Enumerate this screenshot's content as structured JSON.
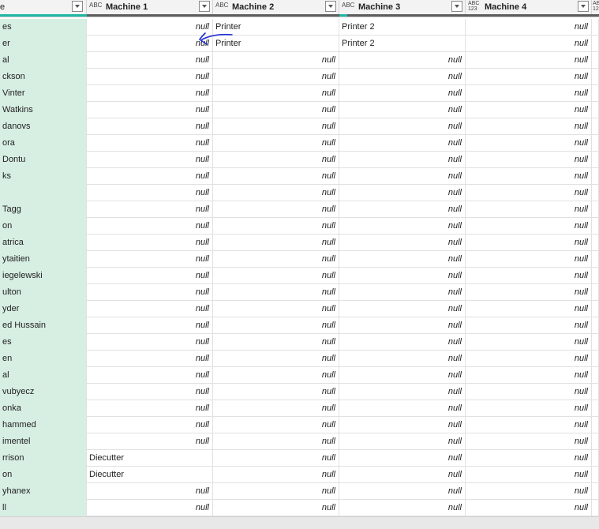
{
  "header": {
    "col0_label": "e",
    "columns": [
      {
        "type_icon": "ABC",
        "label": "Machine 1"
      },
      {
        "type_icon": "ABC",
        "label": "Machine 2"
      },
      {
        "type_icon": "ABC",
        "label": "Machine 3"
      },
      {
        "type_icon": "ABC 123",
        "label": "Machine 4"
      },
      {
        "type_icon": "ABC 12",
        "label": ""
      }
    ]
  },
  "colors": {
    "quality_bar_teal": "#1eb8a6",
    "quality_bar_gray": "#5e5e5e",
    "name_column_bg": "#d7eee3",
    "annotation": "#1f2bd1"
  },
  "null_text": "null",
  "rows": [
    {
      "name": "es",
      "m1": null,
      "m2": "Printer",
      "m3": "Printer 2",
      "m4": null
    },
    {
      "name": "er",
      "m1": null,
      "m2": "Printer",
      "m3": "Printer 2",
      "m4": null
    },
    {
      "name": "al",
      "m1": null,
      "m2": null,
      "m3": null,
      "m4": null
    },
    {
      "name": "ckson",
      "m1": null,
      "m2": null,
      "m3": null,
      "m4": null
    },
    {
      "name": "Vinter",
      "m1": null,
      "m2": null,
      "m3": null,
      "m4": null
    },
    {
      "name": "Watkins",
      "m1": null,
      "m2": null,
      "m3": null,
      "m4": null
    },
    {
      "name": "danovs",
      "m1": null,
      "m2": null,
      "m3": null,
      "m4": null
    },
    {
      "name": "ora",
      "m1": null,
      "m2": null,
      "m3": null,
      "m4": null
    },
    {
      "name": "Dontu",
      "m1": null,
      "m2": null,
      "m3": null,
      "m4": null
    },
    {
      "name": "ks",
      "m1": null,
      "m2": null,
      "m3": null,
      "m4": null
    },
    {
      "name": "",
      "m1": null,
      "m2": null,
      "m3": null,
      "m4": null
    },
    {
      "name": "Tagg",
      "m1": null,
      "m2": null,
      "m3": null,
      "m4": null
    },
    {
      "name": "on",
      "m1": null,
      "m2": null,
      "m3": null,
      "m4": null
    },
    {
      "name": "atrica",
      "m1": null,
      "m2": null,
      "m3": null,
      "m4": null
    },
    {
      "name": "ytaitien",
      "m1": null,
      "m2": null,
      "m3": null,
      "m4": null
    },
    {
      "name": "iegelewski",
      "m1": null,
      "m2": null,
      "m3": null,
      "m4": null
    },
    {
      "name": "ulton",
      "m1": null,
      "m2": null,
      "m3": null,
      "m4": null
    },
    {
      "name": "yder",
      "m1": null,
      "m2": null,
      "m3": null,
      "m4": null
    },
    {
      "name": "ed Hussain",
      "m1": null,
      "m2": null,
      "m3": null,
      "m4": null
    },
    {
      "name": "es",
      "m1": null,
      "m2": null,
      "m3": null,
      "m4": null
    },
    {
      "name": "en",
      "m1": null,
      "m2": null,
      "m3": null,
      "m4": null
    },
    {
      "name": "al",
      "m1": null,
      "m2": null,
      "m3": null,
      "m4": null
    },
    {
      "name": "vubyecz",
      "m1": null,
      "m2": null,
      "m3": null,
      "m4": null
    },
    {
      "name": "onka",
      "m1": null,
      "m2": null,
      "m3": null,
      "m4": null
    },
    {
      "name": "hammed",
      "m1": null,
      "m2": null,
      "m3": null,
      "m4": null
    },
    {
      "name": "imentel",
      "m1": null,
      "m2": null,
      "m3": null,
      "m4": null
    },
    {
      "name": "rrison",
      "m1": "Diecutter",
      "m2": null,
      "m3": null,
      "m4": null
    },
    {
      "name": "on",
      "m1": "Diecutter",
      "m2": null,
      "m3": null,
      "m4": null
    },
    {
      "name": "yhanex",
      "m1": null,
      "m2": null,
      "m3": null,
      "m4": null
    },
    {
      "name": "ll",
      "m1": null,
      "m2": null,
      "m3": null,
      "m4": null
    }
  ]
}
